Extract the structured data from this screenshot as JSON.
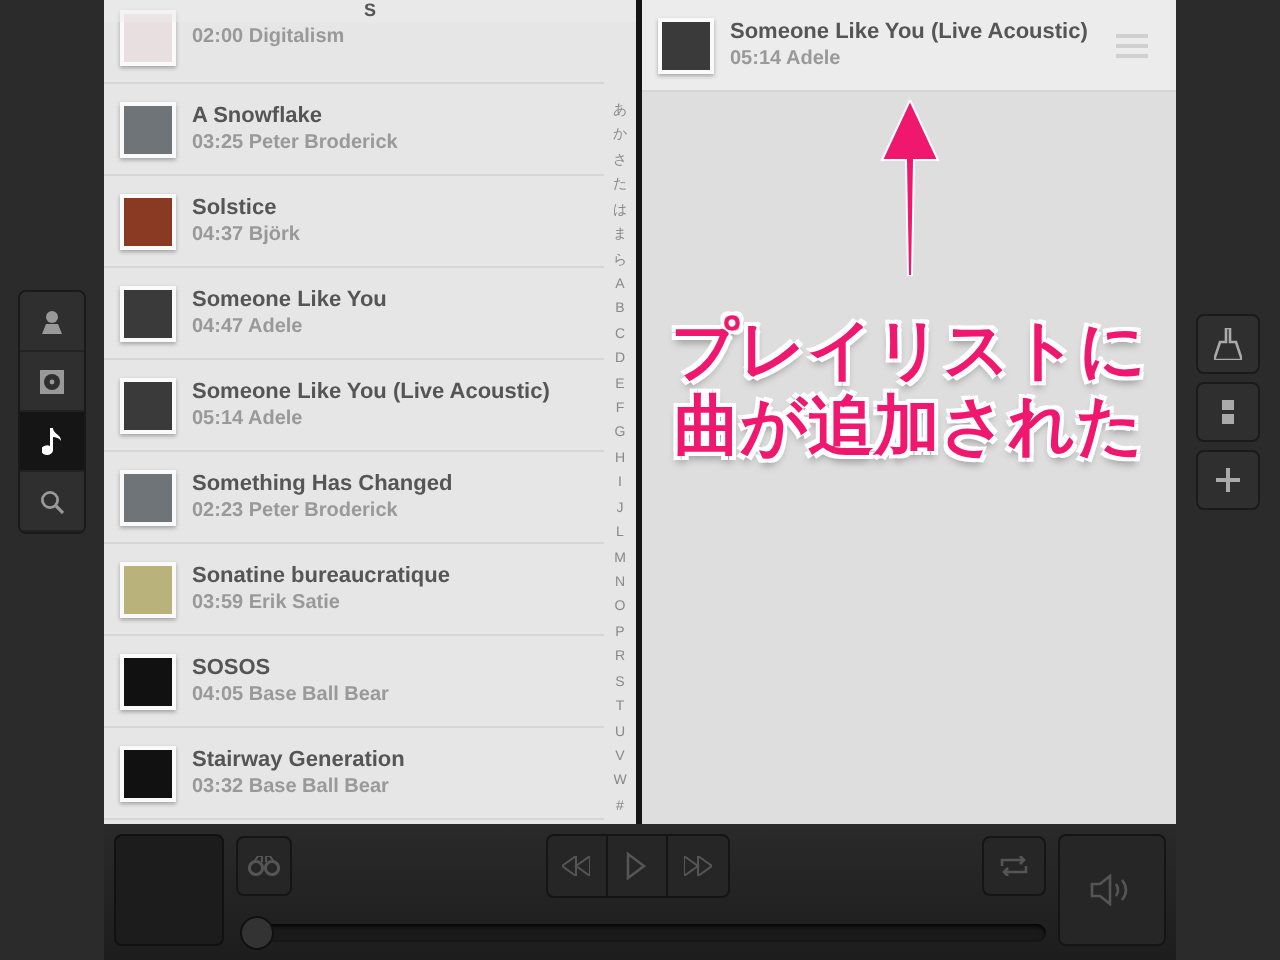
{
  "nav": [
    {
      "selected": false
    },
    {
      "selected": false
    },
    {
      "selected": true
    },
    {
      "selected": false
    }
  ],
  "library": {
    "section_header": "S",
    "songs": [
      {
        "subtitle": "02:00 Digitalism"
      },
      {
        "title": "A Snowflake",
        "subtitle": "03:25 Peter Broderick"
      },
      {
        "title": "Solstice",
        "subtitle": "04:37 Björk"
      },
      {
        "title": "Someone Like You",
        "subtitle": "04:47 Adele"
      },
      {
        "title": "Someone Like You (Live Acoustic)",
        "subtitle": "05:14 Adele"
      },
      {
        "title": "Something Has Changed",
        "subtitle": "02:23 Peter Broderick"
      },
      {
        "title": "Sonatine bureaucratique",
        "subtitle": "03:59 Erik Satie"
      },
      {
        "title": "SOSOS",
        "subtitle": "04:05 Base Ball Bear"
      },
      {
        "title": "Stairway Generation",
        "subtitle": "03:32 Base Ball Bear"
      }
    ],
    "index": [
      "あ",
      "か",
      "さ",
      "た",
      "は",
      "ま",
      "ら",
      "A",
      "B",
      "C",
      "D",
      "E",
      "F",
      "G",
      "H",
      "I",
      "J",
      "L",
      "M",
      "N",
      "O",
      "P",
      "R",
      "S",
      "T",
      "U",
      "V",
      "W",
      "#"
    ]
  },
  "playlist": {
    "songs": [
      {
        "title": "Someone Like You (Live Acoustic)",
        "subtitle": "05:14 Adele"
      }
    ]
  },
  "annotation": {
    "lines": [
      "プレイリストに",
      "曲が追加された"
    ]
  },
  "player": {
    "progress": {
      "level": 0
    }
  }
}
